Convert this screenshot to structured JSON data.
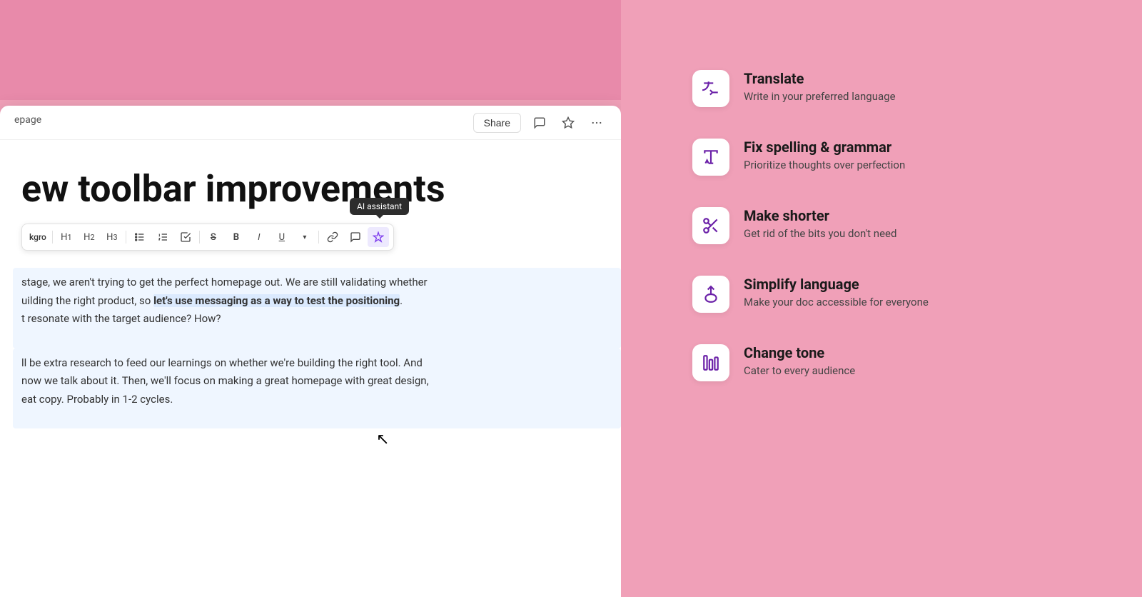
{
  "background": {
    "color": "#f0a0b8"
  },
  "doc": {
    "breadcrumb": "epage",
    "title": "ew toolbar improvements",
    "header": {
      "share_label": "Share"
    },
    "toolbar": {
      "ai_tooltip": "AI assistant",
      "items": [
        {
          "id": "text-style",
          "label": "kgro",
          "type": "text"
        },
        {
          "id": "h1",
          "label": "H₁",
          "type": "icon"
        },
        {
          "id": "h2",
          "label": "H₂",
          "type": "icon"
        },
        {
          "id": "h3",
          "label": "H₃",
          "type": "icon"
        },
        {
          "id": "bullet-list",
          "label": "≡",
          "type": "icon"
        },
        {
          "id": "numbered-list",
          "label": "1.",
          "type": "icon"
        },
        {
          "id": "checklist",
          "label": "☑",
          "type": "icon"
        },
        {
          "id": "strikethrough",
          "label": "S̶",
          "type": "icon"
        },
        {
          "id": "bold",
          "label": "B",
          "type": "icon"
        },
        {
          "id": "italic",
          "label": "I",
          "type": "icon"
        },
        {
          "id": "underline",
          "label": "U",
          "type": "icon"
        },
        {
          "id": "link",
          "label": "🔗",
          "type": "icon"
        },
        {
          "id": "comment",
          "label": "💬",
          "type": "icon"
        },
        {
          "id": "ai",
          "label": "✦",
          "type": "icon",
          "active": true
        }
      ]
    },
    "paragraphs": [
      {
        "id": "p1",
        "text_before": "stage, we aren't trying to get the perfect homepage out. We are still validating whether",
        "text_highlighted_prefix": "uilding the right product, so ",
        "text_highlighted": "let's use messaging as a way to test the positioning",
        "text_after": ".",
        "text_line2": "t resonate with the target audience? How?"
      },
      {
        "id": "p2",
        "text": "ll be extra research to feed our learnings on whether we're building the right tool. And\nnow we talk about it. Then, we'll focus on making a great homepage with great design,\neat copy. Probably in 1-2 cycles."
      }
    ]
  },
  "ai_features": [
    {
      "id": "translate",
      "title": "Translate",
      "description": "Write in your preferred language",
      "icon": "translate"
    },
    {
      "id": "fix-spelling",
      "title": "Fix spelling & grammar",
      "description": "Prioritize thoughts over perfection",
      "icon": "spelling"
    },
    {
      "id": "make-shorter",
      "title": "Make shorter",
      "description": "Get rid of the bits you don't need",
      "icon": "scissors"
    },
    {
      "id": "simplify-language",
      "title": "Simplify language",
      "description": "Make your doc accessible for everyone",
      "icon": "simplify"
    },
    {
      "id": "change-tone",
      "title": "Change tone",
      "description": "Cater to every audience",
      "icon": "tone"
    }
  ]
}
